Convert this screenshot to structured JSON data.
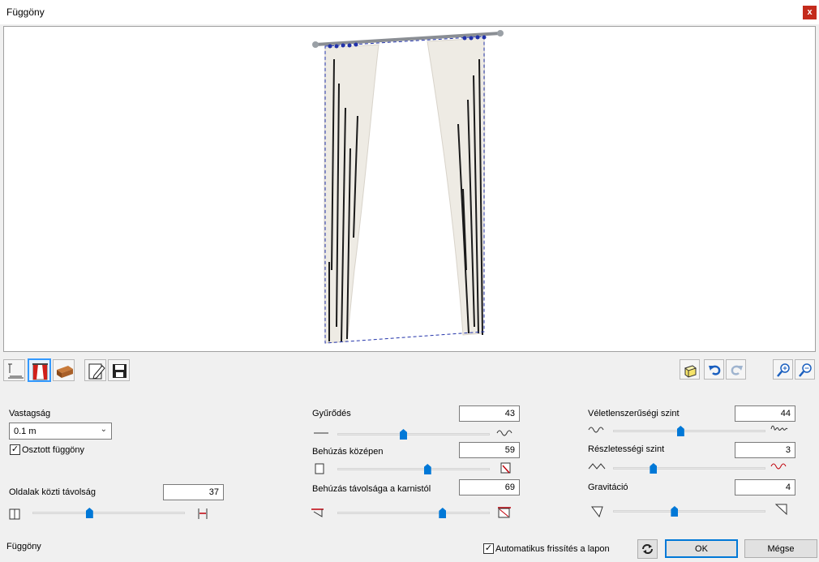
{
  "window": {
    "title": "Függöny",
    "close_label": "x"
  },
  "toolbar": {
    "left": [
      "dimensions-icon",
      "curtain-icon",
      "material-icon",
      "edit-icon",
      "save-icon"
    ],
    "right": [
      "cube-icon",
      "undo-icon",
      "redo-icon",
      "zoom-in-icon",
      "zoom-out-icon"
    ]
  },
  "col1": {
    "thickness_label": "Vastagság",
    "thickness_value": "0.1 m",
    "split_label": "Osztott függöny",
    "split_checked": true,
    "distance_label": "Oldalak közti távolság",
    "distance_value": "37",
    "distance_fraction": 0.37
  },
  "col2": {
    "wrinkle_label": "Gyűrődés",
    "wrinkle_value": "43",
    "wrinkle_fraction": 0.43,
    "center_label": "Behúzás középen",
    "center_value": "59",
    "center_fraction": 0.59,
    "rod_label": "Behúzás távolsága a karnistól",
    "rod_value": "69",
    "rod_fraction": 0.69
  },
  "col3": {
    "random_label": "Véletlenszerűségi szint",
    "random_value": "44",
    "random_fraction": 0.44,
    "detail_label": "Részletességi szint",
    "detail_value": "3",
    "detail_fraction": 0.26,
    "gravity_label": "Gravitáció",
    "gravity_value": "4",
    "gravity_fraction": 0.4
  },
  "footer": {
    "status": "Függöny",
    "auto_refresh_label": "Automatikus frissítés a lapon",
    "auto_refresh_checked": true,
    "ok_label": "OK",
    "cancel_label": "Mégse"
  }
}
